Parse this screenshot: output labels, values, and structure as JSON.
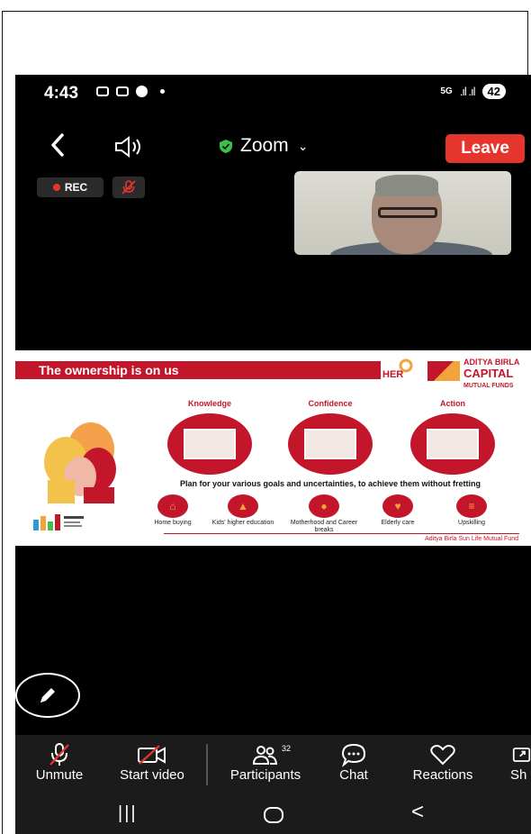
{
  "status_bar": {
    "time": "4:43",
    "network": "5G",
    "signal": ".ıl .ıl",
    "battery": "42"
  },
  "header": {
    "meeting_title": "Zoom",
    "leave_label": "Leave"
  },
  "meeting": {
    "recording_label": "REC"
  },
  "slide": {
    "banner": "The ownership is on us",
    "her_logo": "HER",
    "brand_line1": "ADITYA BIRLA",
    "brand_line2": "CAPITAL",
    "brand_line3": "MUTUAL FUNDS",
    "pillars": [
      {
        "title": "Knowledge"
      },
      {
        "title": "Confidence"
      },
      {
        "title": "Action"
      }
    ],
    "plan_text": "Plan for your various goals and uncertainties, to achieve them without fretting",
    "goals": [
      {
        "label": "Home buying"
      },
      {
        "label": "Kids' higher education"
      },
      {
        "label": "Motherhood and Career breaks"
      },
      {
        "label": "Elderly care"
      },
      {
        "label": "Upskilling"
      }
    ],
    "footer": "Aditya Birla Sun Life Mutual Fund"
  },
  "toolbar": {
    "unmute": "Unmute",
    "start_video": "Start video",
    "participants": "Participants",
    "participants_count": "32",
    "chat": "Chat",
    "reactions": "Reactions",
    "share": "Sh"
  },
  "colors": {
    "leave_red": "#e5352c",
    "slide_red": "#c4162a",
    "toolbar_bg": "#1b1b1b"
  }
}
